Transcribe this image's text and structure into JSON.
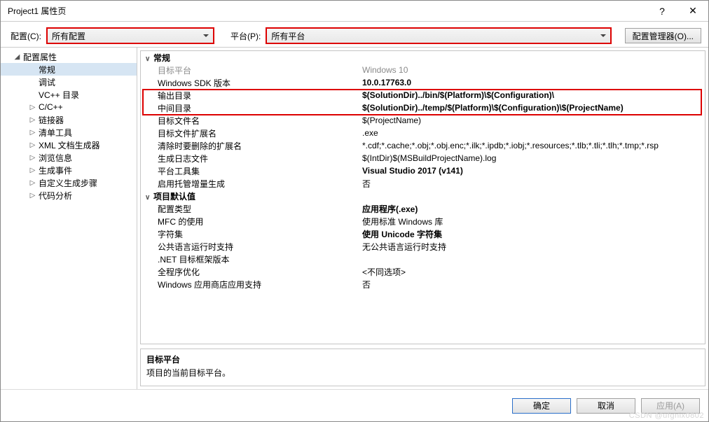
{
  "window": {
    "title": "Project1 属性页"
  },
  "toolbar": {
    "config_label": "配置(C):",
    "config_value": "所有配置",
    "platform_label": "平台(P):",
    "platform_value": "所有平台",
    "manager_label": "配置管理器(O)..."
  },
  "tree": {
    "root": "配置属性",
    "items": [
      {
        "label": "常规",
        "selected": true,
        "leaf": true
      },
      {
        "label": "调试",
        "leaf": true
      },
      {
        "label": "VC++ 目录",
        "leaf": true
      },
      {
        "label": "C/C++",
        "expandable": true
      },
      {
        "label": "链接器",
        "expandable": true
      },
      {
        "label": "清单工具",
        "expandable": true
      },
      {
        "label": "XML 文档生成器",
        "expandable": true
      },
      {
        "label": "浏览信息",
        "expandable": true
      },
      {
        "label": "生成事件",
        "expandable": true
      },
      {
        "label": "自定义生成步骤",
        "expandable": true
      },
      {
        "label": "代码分析",
        "expandable": true
      }
    ]
  },
  "grid": {
    "group1": "常规",
    "rows1": [
      {
        "k": "目标平台",
        "v": "Windows 10",
        "dim": true
      },
      {
        "k": "Windows SDK 版本",
        "v": "10.0.17763.0",
        "bold": true
      },
      {
        "k": "输出目录",
        "v": "$(SolutionDir)../bin/$(Platform)\\$(Configuration)\\",
        "bold": true,
        "hl": true
      },
      {
        "k": "中间目录",
        "v": "$(SolutionDir)../temp/$(Platform)\\$(Configuration)\\$(ProjectName)",
        "bold": true,
        "hl": true
      },
      {
        "k": "目标文件名",
        "v": "$(ProjectName)"
      },
      {
        "k": "目标文件扩展名",
        "v": ".exe"
      },
      {
        "k": "清除时要删除的扩展名",
        "v": "*.cdf;*.cache;*.obj;*.obj.enc;*.ilk;*.ipdb;*.iobj;*.resources;*.tlb;*.tli;*.tlh;*.tmp;*.rsp"
      },
      {
        "k": "生成日志文件",
        "v": "$(IntDir)$(MSBuildProjectName).log"
      },
      {
        "k": "平台工具集",
        "v": "Visual Studio 2017 (v141)",
        "bold": true
      },
      {
        "k": "启用托管增量生成",
        "v": "否"
      }
    ],
    "group2": "项目默认值",
    "rows2": [
      {
        "k": "配置类型",
        "v": "应用程序(.exe)",
        "bold": true
      },
      {
        "k": "MFC 的使用",
        "v": "使用标准 Windows 库"
      },
      {
        "k": "字符集",
        "v": "使用 Unicode 字符集",
        "bold": true
      },
      {
        "k": "公共语言运行时支持",
        "v": "无公共语言运行时支持"
      },
      {
        "k": ".NET 目标框架版本",
        "v": ""
      },
      {
        "k": "全程序优化",
        "v": "<不同选项>"
      },
      {
        "k": "Windows 应用商店应用支持",
        "v": "否"
      }
    ]
  },
  "desc": {
    "title": "目标平台",
    "body": "项目的当前目标平台。"
  },
  "footer": {
    "ok": "确定",
    "cancel": "取消",
    "apply": "应用(A)"
  },
  "watermark": "CSDN @ufgnix0802"
}
